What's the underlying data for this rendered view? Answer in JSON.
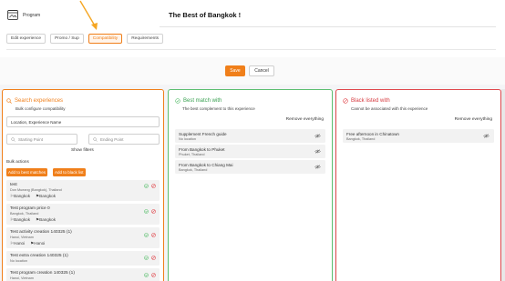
{
  "header": {
    "program_label": "Program",
    "page_title": "The Best of Bangkok !",
    "tabs": [
      "Edit experience",
      "Promo / Sup",
      "Compatibility",
      "Requirements"
    ],
    "active_tab": "Compatibility"
  },
  "actions": {
    "save": "Save",
    "cancel": "Cancel"
  },
  "search_panel": {
    "title": "Search experiences",
    "subtitle": "Bulk configure compatibility",
    "search_placeholder": "Location, Experience Name",
    "starting_point": "Starting Point",
    "ending_point": "Ending Point",
    "show_filters": "Show filters",
    "bulk_actions": "Bulk actions",
    "add_best": "Add to best matches",
    "add_black": "Add to black list",
    "items": [
      {
        "title": "test",
        "location": "Don Mueang (Bangkok), Thailand",
        "tags": [
          "Bangkok",
          "Bangkok"
        ]
      },
      {
        "title": "Test program price 0",
        "location": "Bangkok, Thailand",
        "tags": [
          "Bangkok",
          "Bangkok"
        ]
      },
      {
        "title": "Test activity creation 140325 (1)",
        "location": "Hanoi, Vietnam",
        "tags": [
          "Hanoi",
          "Hanoi"
        ]
      },
      {
        "title": "Test extra creation 140325 (1)",
        "location": "No location",
        "tags": []
      },
      {
        "title": "Test program creation 140325 (1)",
        "location": "Hanoi, Vietnam",
        "tags": []
      }
    ]
  },
  "best_panel": {
    "title": "Best match with",
    "subtitle": "The best complement to this experience",
    "remove_all": "Remove everything",
    "items": [
      {
        "title": "Supplement French guide",
        "location": "No location"
      },
      {
        "title": "From Bangkok to Phuket",
        "location": "Phuket, Thailand"
      },
      {
        "title": "From Bangkok to Chiang Mai",
        "location": "Bangkok, Thailand"
      }
    ]
  },
  "black_panel": {
    "title": "Black listed with",
    "subtitle": "Cannot be associated with this experience",
    "remove_all": "Remove everything",
    "items": [
      {
        "title": "Free afternoon in Chinatown",
        "location": "Bangkok, Thailand"
      }
    ]
  },
  "colors": {
    "orange": "#f07f1a",
    "green": "#5cbf70",
    "red": "#e0474c"
  }
}
